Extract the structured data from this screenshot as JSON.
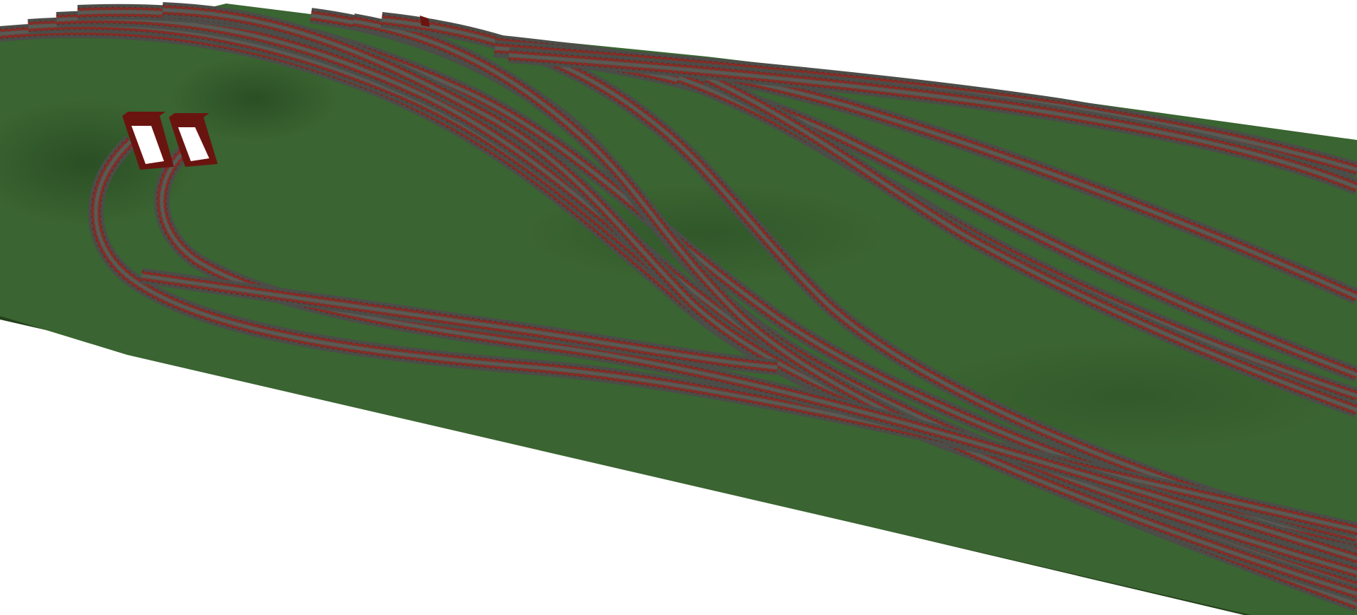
{
  "viewport": {
    "background": "#ffffff"
  },
  "terrain": {
    "top_color": "#3a6431",
    "top_shade_color": "#2f5529",
    "side_color": "#22401a",
    "hill_shadow_color": "#2a4d24"
  },
  "track": {
    "ballast_color": "#4c4c48",
    "sleeper_color": "#6e1e1a",
    "rail_color": "#8a2a22"
  },
  "portals": {
    "count": 2,
    "frame_color": "#6a1410",
    "opening_color": "#ffffff"
  },
  "track_count": 17
}
